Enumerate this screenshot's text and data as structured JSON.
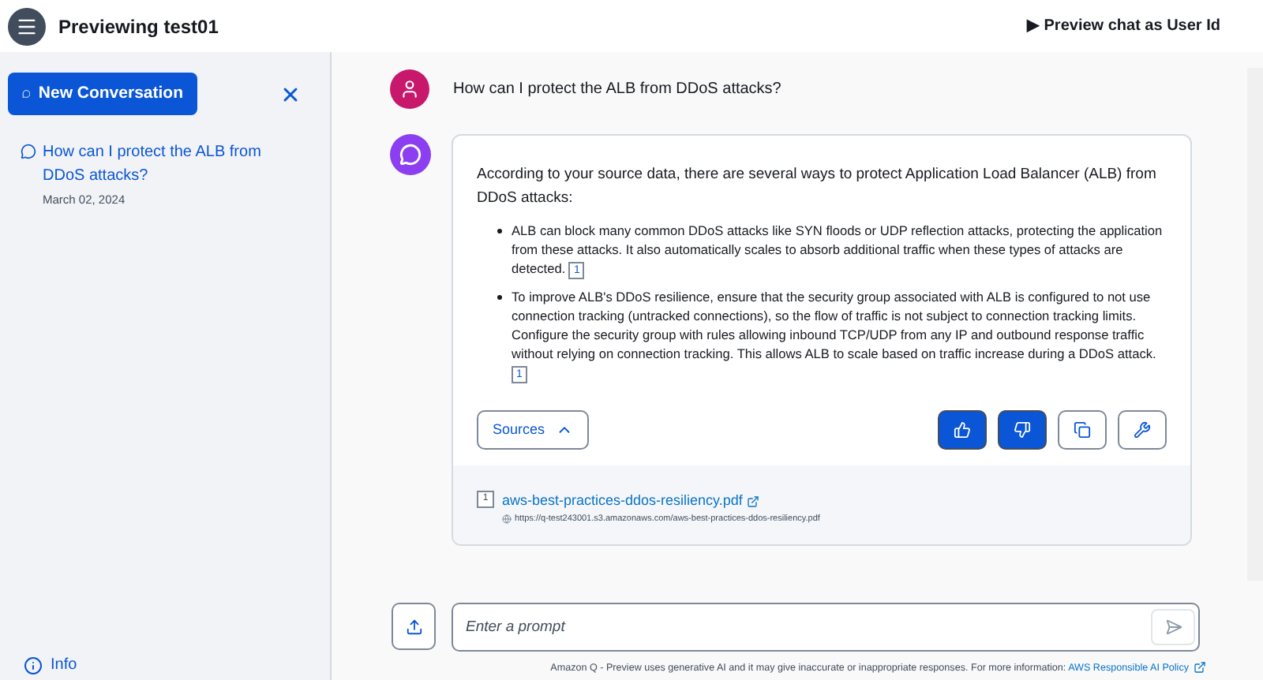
{
  "header": {
    "title": "Previewing test01",
    "preview_toggle": "▶ Preview chat as User Id"
  },
  "sidebar": {
    "new_button": "New Conversation",
    "conversations": [
      {
        "title": "How can I protect the ALB from DDoS attacks?",
        "date": "March 02, 2024",
        "selected": true
      }
    ],
    "info": "Info"
  },
  "chat": {
    "question": "How can I protect the ALB from DDoS attacks?",
    "answer": {
      "intro": "According to your source data, there are several ways to protect Application Load Balancer (ALB) from DDoS attacks:",
      "bullets": [
        {
          "text": "ALB can block many common DDoS attacks like SYN floods or UDP reflection attacks, protecting the application from these attacks. It also automatically scales to absorb additional traffic when these types of attacks are detected.",
          "citation": "1"
        },
        {
          "text": "To improve ALB's DDoS resilience, ensure that the security group associated with ALB is configured to not use connection tracking (untracked connections), so the flow of traffic is not subject to connection tracking limits. Configure the security group with rules allowing inbound TCP/UDP from any IP and outbound response traffic without relying on connection tracking. This allows ALB to scale based on traffic increase during a DDoS attack.",
          "citation": "1"
        }
      ],
      "sources_button": "Sources",
      "sources_expanded": true,
      "actions": [
        {
          "kind": "thumbs-up",
          "filled": true
        },
        {
          "kind": "thumbs-down",
          "filled": true
        },
        {
          "kind": "copy",
          "filled": false
        },
        {
          "kind": "wrench",
          "filled": false
        }
      ],
      "sources": [
        {
          "number": "1",
          "title": "aws-best-practices-ddos-resiliency.pdf",
          "url": "https://q-test243001.s3.amazonaws.com/aws-best-practices-ddos-resiliency.pdf"
        }
      ]
    }
  },
  "prompt": {
    "placeholder": "Enter a prompt"
  },
  "footer": {
    "text": "Amazon Q - Preview uses generative AI and it may give inaccurate or inappropriate responses. For more information:",
    "link": "AWS Responsible AI Policy"
  }
}
